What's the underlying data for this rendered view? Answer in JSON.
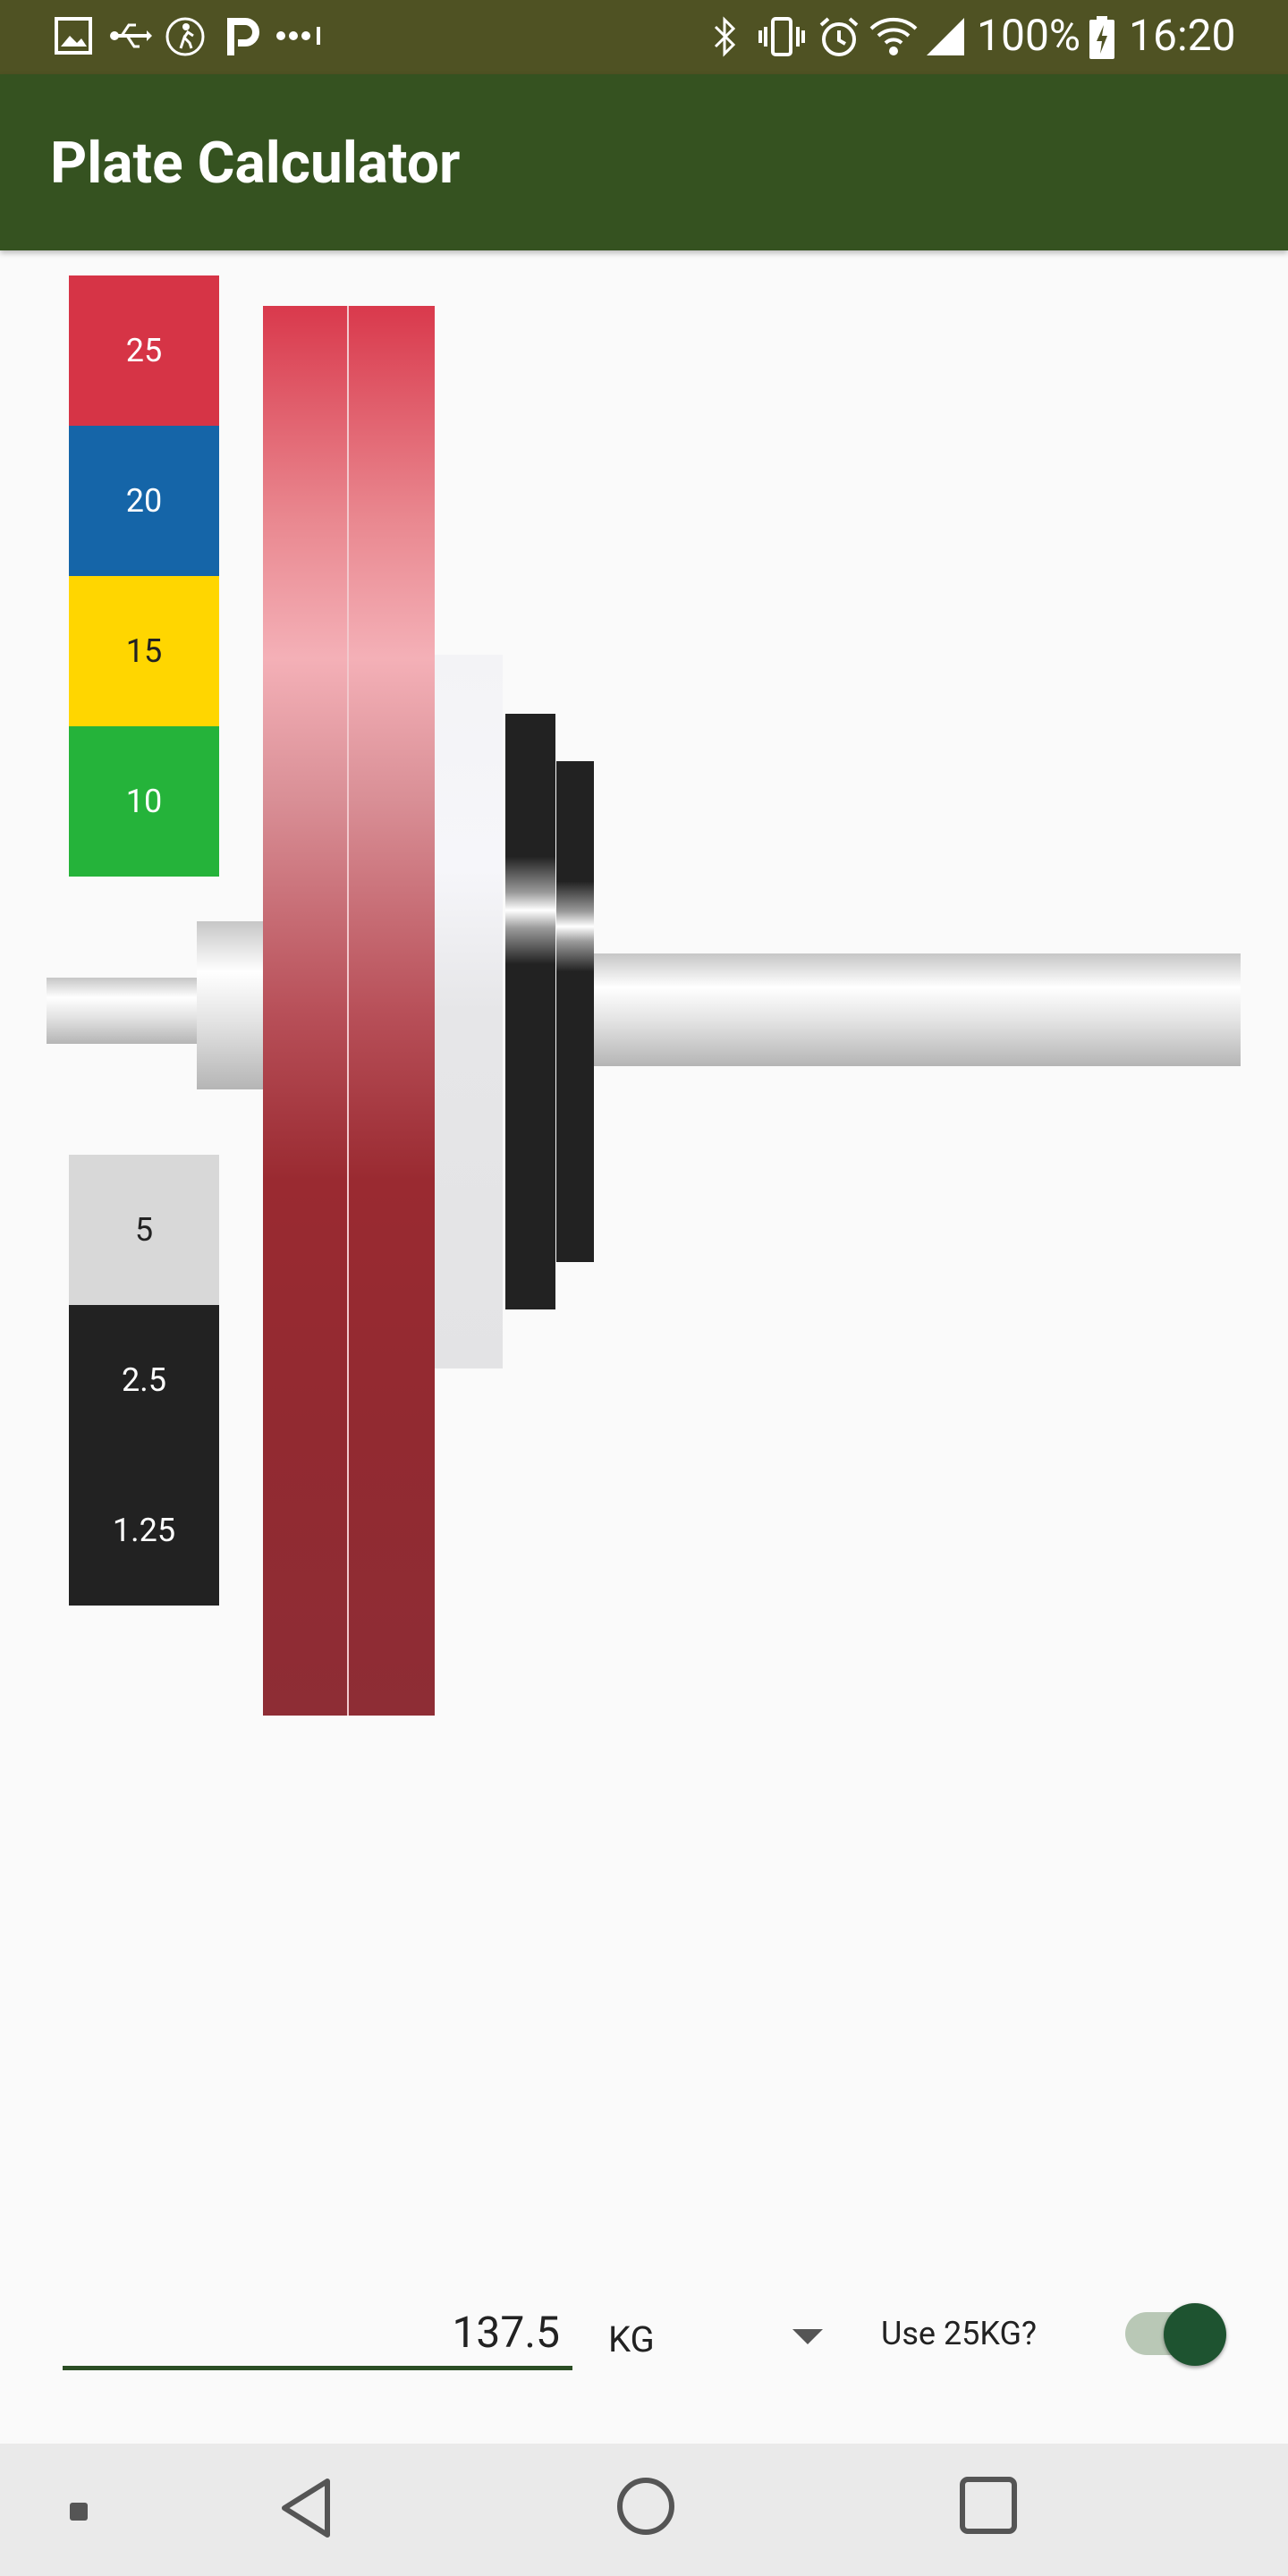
{
  "status_bar": {
    "battery": "100%",
    "time": "16:20",
    "icons": [
      "image-icon",
      "usb-icon",
      "accessibility-icon",
      "parking-icon",
      "more-dots-icon",
      "bluetooth-icon",
      "vibrate-icon",
      "alarm-icon",
      "wifi-icon",
      "signal-icon",
      "battery-charging-icon"
    ]
  },
  "app_bar": {
    "title": "Plate Calculator"
  },
  "legend": {
    "top": [
      {
        "label": "25",
        "color": "#d63446",
        "text_color": "#ffffff"
      },
      {
        "label": "20",
        "color": "#1565a8",
        "text_color": "#ffffff"
      },
      {
        "label": "15",
        "color": "#ffd600",
        "text_color": "#222222"
      },
      {
        "label": "10",
        "color": "#25b33a",
        "text_color": "#ffffff"
      }
    ],
    "bottom": [
      {
        "label": "5",
        "color": "#d8d8d8",
        "text_color": "#222222"
      },
      {
        "label": "2.5",
        "color": "#222222",
        "text_color": "#ffffff"
      },
      {
        "label": "1.25",
        "color": "#222222",
        "text_color": "#ffffff"
      }
    ]
  },
  "barbell": {
    "plates_loaded": [
      "25",
      "25",
      "5",
      "2.5",
      "1.25"
    ]
  },
  "controls": {
    "weight_value": "137.5",
    "unit": "KG",
    "use25_label": "Use 25KG?",
    "use25_enabled": true
  },
  "colors": {
    "app_bar": "#355220",
    "status_bar": "#4f5223",
    "accent": "#1e5330"
  }
}
